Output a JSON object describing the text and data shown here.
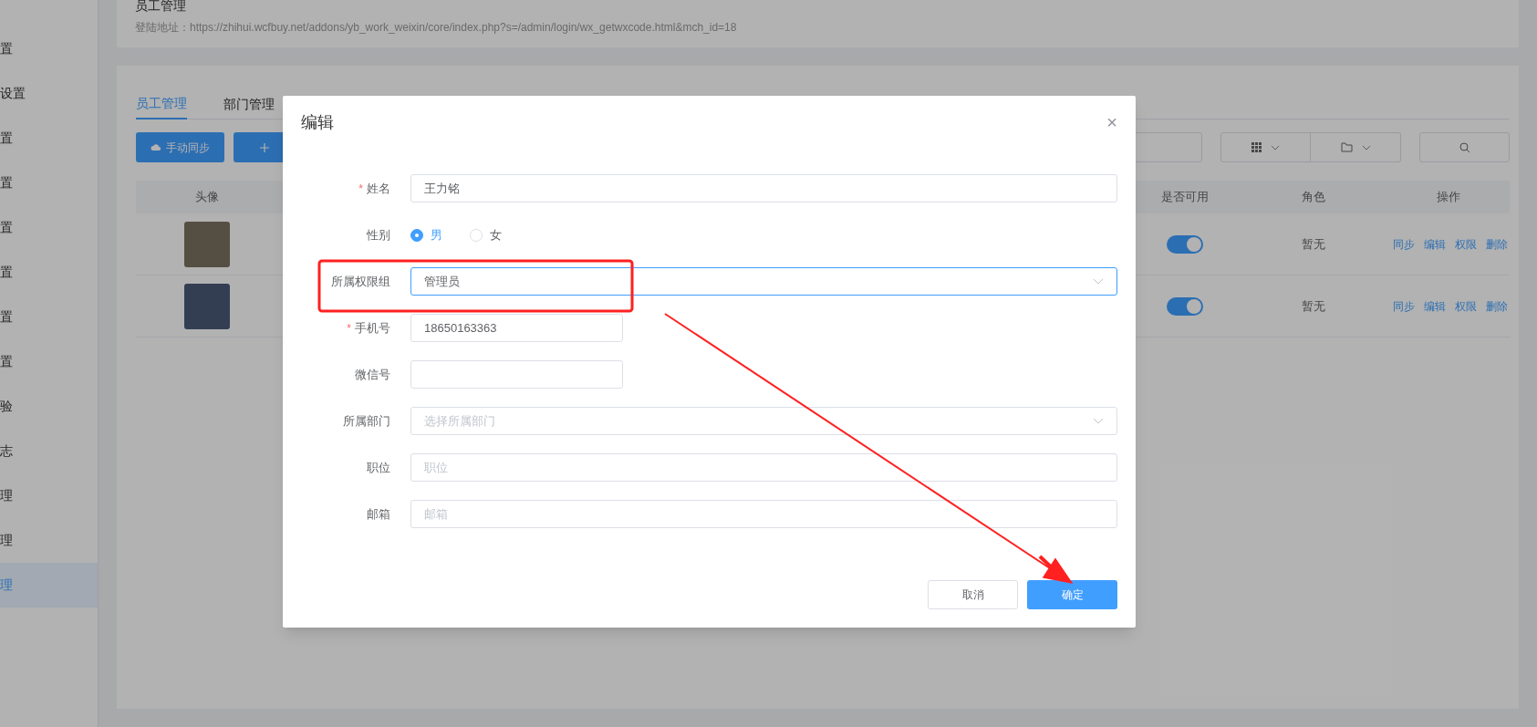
{
  "sidebar": {
    "items": [
      {
        "label": "置",
        "selected": false
      },
      {
        "label": "设置",
        "selected": false
      },
      {
        "label": "置",
        "selected": false
      },
      {
        "label": "置",
        "selected": false
      },
      {
        "label": "置",
        "selected": false
      },
      {
        "label": "置",
        "selected": false
      },
      {
        "label": "置",
        "selected": false
      },
      {
        "label": "置",
        "selected": false
      },
      {
        "label": "验",
        "selected": false
      },
      {
        "label": "志",
        "selected": false
      },
      {
        "label": "理",
        "selected": false
      },
      {
        "label": "理",
        "selected": false
      },
      {
        "label": "理",
        "selected": true
      }
    ]
  },
  "header": {
    "title": "员工管理",
    "login_url": "登陆地址：https://zhihui.wcfbuy.net/addons/yb_work_weixin/core/index.php?s=/admin/login/wx_getwxcode.html&mch_id=18"
  },
  "tabs": [
    {
      "label": "员工管理",
      "selected": true
    },
    {
      "label": "部门管理",
      "selected": false
    }
  ],
  "toolbar": {
    "sync_button": "手动同步"
  },
  "table": {
    "columns": [
      "头像",
      "是否可用",
      "角色",
      "操作"
    ],
    "rows": [
      {
        "enabled": true,
        "role": "暂无",
        "actions": [
          "同步",
          "编辑",
          "权限",
          "删除"
        ]
      },
      {
        "enabled": true,
        "role": "暂无",
        "actions": [
          "同步",
          "编辑",
          "权限",
          "删除"
        ]
      }
    ]
  },
  "dialog": {
    "title": "编辑",
    "close": "×",
    "fields": [
      {
        "kind": "text",
        "label": "姓名",
        "required_mark": "*",
        "value": "王力铭",
        "short": false
      },
      {
        "kind": "radio",
        "label": "性别",
        "options": [
          {
            "label": "男",
            "selected": true
          },
          {
            "label": "女",
            "selected": false
          }
        ]
      },
      {
        "kind": "select",
        "label": "所属权限组",
        "value": "管理员",
        "focused": true
      },
      {
        "kind": "text",
        "label": "手机号",
        "required_mark": "*",
        "value": "18650163363",
        "short": true
      },
      {
        "kind": "text",
        "label": "微信号",
        "short": true
      },
      {
        "kind": "select",
        "label": "所属部门",
        "placeholder": "选择所属部门",
        "focused": false
      },
      {
        "kind": "text",
        "label": "职位",
        "placeholder": "职位",
        "short": false
      },
      {
        "kind": "text",
        "label": "邮箱",
        "placeholder": "邮箱",
        "short": false
      }
    ],
    "buttons": [
      {
        "label": "取消",
        "primary": false
      },
      {
        "label": "确定",
        "primary": true
      }
    ]
  }
}
